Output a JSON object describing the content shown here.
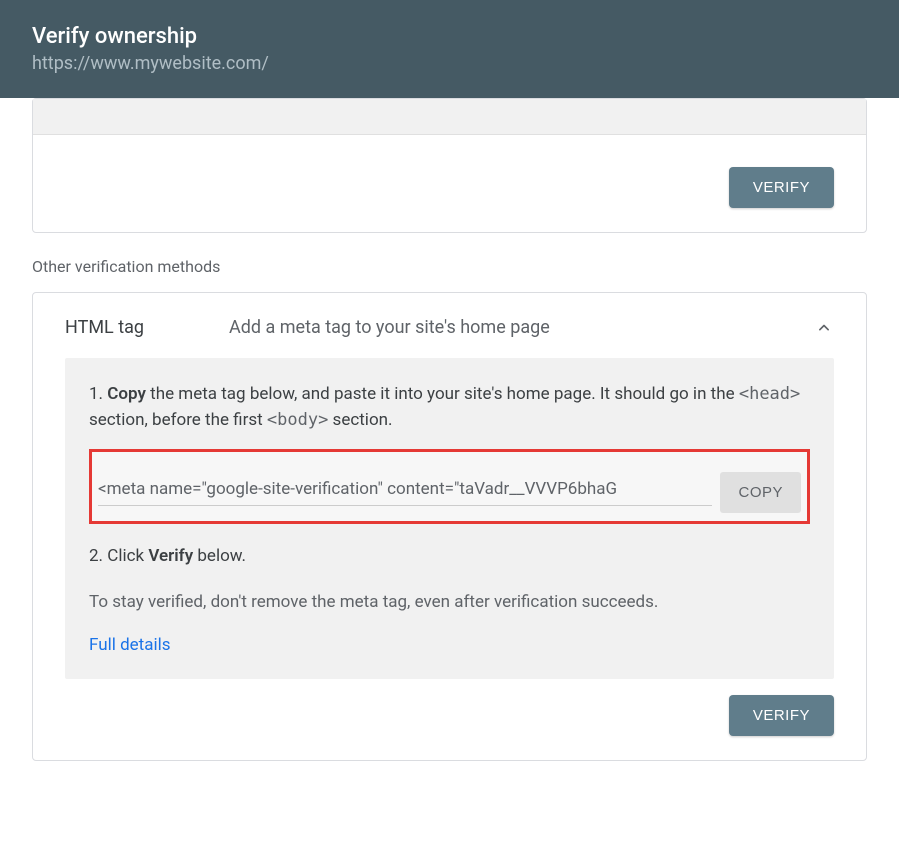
{
  "header": {
    "title": "Verify ownership",
    "url": "https://www.mywebsite.com/"
  },
  "section_label": "Other verification methods",
  "method": {
    "name": "HTML tag",
    "desc": "Add a meta tag to your site's home page"
  },
  "step1": {
    "prefix": "1. ",
    "bold": "Copy",
    "text_a": " the meta tag below, and paste it into your site's home page. It should go in the ",
    "code1": "<head>",
    "text_b": " section, before the first ",
    "code2": "<body>",
    "text_c": " section."
  },
  "meta_tag": "<meta name=\"google-site-verification\" content=\"taVadr__VVVP6bhaG",
  "copy_label": "COPY",
  "step2": {
    "prefix": "2. Click ",
    "bold": "Verify",
    "suffix": " below."
  },
  "note": "To stay verified, don't remove the meta tag, even after verification succeeds.",
  "full_details": "Full details",
  "verify_label": "VERIFY"
}
